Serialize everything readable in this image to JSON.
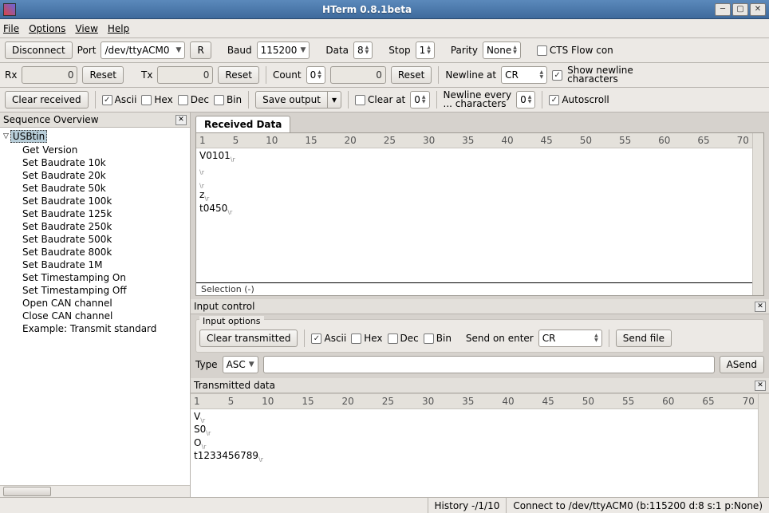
{
  "window": {
    "title": "HTerm 0.8.1beta"
  },
  "menu": {
    "file": "File",
    "options": "Options",
    "view": "View",
    "help": "Help"
  },
  "toolbar1": {
    "disconnect": "Disconnect",
    "port_label": "Port",
    "port_value": "/dev/ttyACM0",
    "reload": "R",
    "baud_label": "Baud",
    "baud_value": "115200",
    "data_label": "Data",
    "data_value": "8",
    "stop_label": "Stop",
    "stop_value": "1",
    "parity_label": "Parity",
    "parity_value": "None",
    "cts": "CTS Flow con"
  },
  "toolbar2": {
    "rx_label": "Rx",
    "rx_value": "0",
    "reset_rx": "Reset",
    "tx_label": "Tx",
    "tx_value": "0",
    "reset_tx": "Reset",
    "count_label": "Count",
    "count_spin": "0",
    "count_read": "0",
    "reset_count": "Reset",
    "newline_at": "Newline at",
    "newline_val": "CR",
    "shownl1": "Show newline",
    "shownl2": "characters"
  },
  "toolbar3": {
    "clear_rx": "Clear received",
    "ascii": "Ascii",
    "hex": "Hex",
    "dec": "Dec",
    "bin": "Bin",
    "save": "Save output",
    "clear_at": "Clear at",
    "clear_at_val": "0",
    "nlevery1": "Newline every",
    "nlevery2": "... characters",
    "nlevery_val": "0",
    "autoscroll": "Autoscroll"
  },
  "sidebar": {
    "title": "Sequence Overview",
    "root": "USBtin",
    "items": [
      "Get Version",
      "Set Baudrate 10k",
      "Set Baudrate 20k",
      "Set Baudrate 50k",
      "Set Baudrate 100k",
      "Set Baudrate 125k",
      "Set Baudrate 250k",
      "Set Baudrate 500k",
      "Set Baudrate 800k",
      "Set Baudrate 1M",
      "Set Timestamping On",
      "Set Timestamping Off",
      "Open CAN channel",
      "Close CAN channel",
      "Example: Transmit standard"
    ]
  },
  "received": {
    "tab": "Received Data",
    "ruler": [
      "1",
      "5",
      "10",
      "15",
      "20",
      "25",
      "30",
      "35",
      "40",
      "45",
      "50",
      "55",
      "60",
      "65",
      "70"
    ],
    "lines": [
      "V0101",
      "",
      "",
      "z",
      "t0450"
    ],
    "selection": "Selection (-)"
  },
  "inputctrl": {
    "title": "Input control",
    "options_title": "Input options",
    "clear_tx": "Clear transmitted",
    "ascii": "Ascii",
    "hex": "Hex",
    "dec": "Dec",
    "bin": "Bin",
    "sendon": "Send on enter",
    "sendon_val": "CR",
    "sendfile": "Send file",
    "type_label": "Type",
    "type_mode": "ASC",
    "asend": "ASend"
  },
  "transmitted": {
    "title": "Transmitted data",
    "ruler": [
      "1",
      "5",
      "10",
      "15",
      "20",
      "25",
      "30",
      "35",
      "40",
      "45",
      "50",
      "55",
      "60",
      "65",
      "70"
    ],
    "lines": [
      "V",
      "S0",
      "O",
      "t1233456789"
    ]
  },
  "status": {
    "history": "History -/1/10",
    "conn": "Connect to /dev/ttyACM0 (b:115200 d:8 s:1 p:None)"
  }
}
